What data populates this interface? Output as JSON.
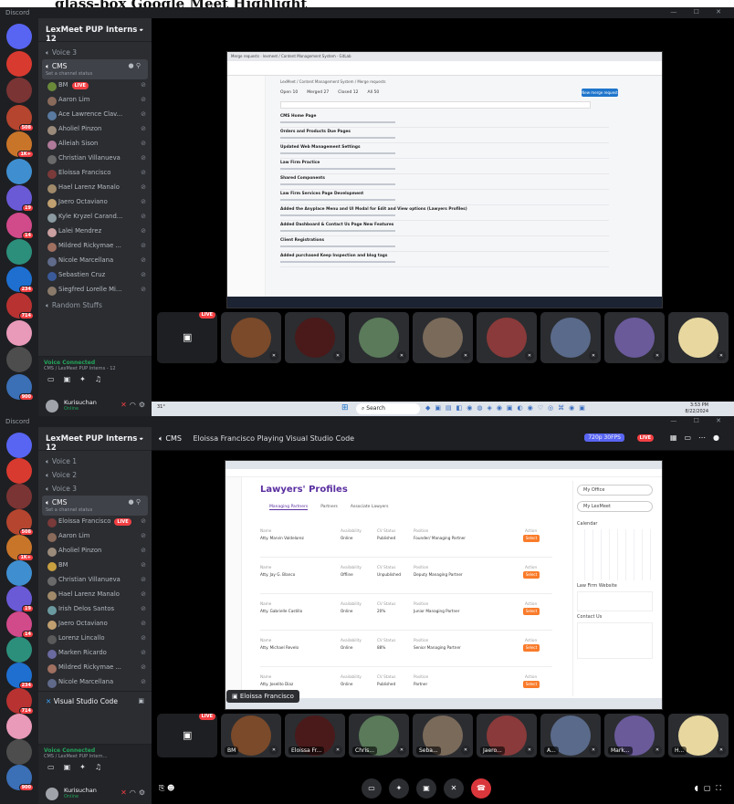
{
  "headline": "glass-box Google Meet Highlight",
  "window": {
    "app_name": "Discord",
    "controls": "— ☐ ✕"
  },
  "server": {
    "name": "LexMeet PUP Interns - 12"
  },
  "servers": [
    {
      "color": "#5865f2",
      "badge": ""
    },
    {
      "color": "#d93a2f",
      "badge": ""
    },
    {
      "color": "#7a3434",
      "badge": ""
    },
    {
      "color": "#b5452f",
      "badge": "508"
    },
    {
      "color": "#c8752a",
      "badge": "1K+"
    },
    {
      "color": "#3f8fd0",
      "badge": ""
    },
    {
      "color": "#6a5ad6",
      "badge": "19"
    },
    {
      "color": "#d14a8a",
      "badge": "14"
    },
    {
      "color": "#2c8f7c",
      "badge": ""
    },
    {
      "color": "#1e6fd0",
      "badge": "234"
    },
    {
      "color": "#b83232",
      "badge": "714"
    },
    {
      "color": "#e89ab8",
      "badge": ""
    },
    {
      "color": "#4d4d4d",
      "badge": ""
    },
    {
      "color": "#3b6fb6",
      "badge": "900"
    }
  ],
  "panel1": {
    "channels": [
      {
        "icon": "speaker",
        "label": "Voice 3"
      }
    ],
    "current": {
      "label": "CMS",
      "status": "Set a channel status"
    },
    "members": [
      {
        "name": "BM",
        "live": true,
        "color": "#6a8a3a"
      },
      {
        "name": "Aaron Lim",
        "live": false,
        "color": "#8a6a5a"
      },
      {
        "name": "Ace Lawrence Clav...",
        "live": false,
        "color": "#5a7aa0"
      },
      {
        "name": "Aholiel Pinzon",
        "live": false,
        "color": "#9a8a7a"
      },
      {
        "name": "Alleiah Sison",
        "live": false,
        "color": "#b07a9a"
      },
      {
        "name": "Christian Villanueva",
        "live": false,
        "color": "#6a6a6a"
      },
      {
        "name": "Eloissa Francisco",
        "live": false,
        "color": "#7a3a3a"
      },
      {
        "name": "Hael Larenz Manalo",
        "live": false,
        "color": "#a08a6a"
      },
      {
        "name": "Jaero Octaviano",
        "live": false,
        "color": "#c0a070"
      },
      {
        "name": "Kyle Kryzel Carand...",
        "live": false,
        "color": "#8a9aa0"
      },
      {
        "name": "Lalei Mendrez",
        "live": false,
        "color": "#caa0a0"
      },
      {
        "name": "Mildred Rickymae ...",
        "live": false,
        "color": "#a07060"
      },
      {
        "name": "Nicole Marcellana",
        "live": false,
        "color": "#606a8a"
      },
      {
        "name": "Sebastien Cruz",
        "live": false,
        "color": "#3a5a9a"
      },
      {
        "name": "Siegfred Lorelle Mi...",
        "live": false,
        "color": "#8a7a6a"
      }
    ],
    "after": {
      "label": "Random Stuffs"
    },
    "voice": {
      "title": "Voice Connected",
      "sub": "CMS / LexMeet PUP Interns - 12"
    },
    "user": {
      "name": "Kurisuchan",
      "status": "Online"
    },
    "stream": {
      "browser_tab": "Merge requests · lexmeet / Content Management System · GitLab",
      "breadcrumb": "LexMeet / Content Management System / Merge requests",
      "tabs": [
        "Open 10",
        "Merged 27",
        "Closed 12",
        "All 50"
      ],
      "new_button": "New merge request",
      "items": [
        "CMS Home Page",
        "Orders and Products Due Pages",
        "Updated Web Management Settings",
        "Law Firm Practice",
        "Shared Components",
        "Law Firm Services Page Development",
        "Added the Anyplace Menu and UI Modal for Edit and View options (Lawyers Profiles)",
        "Added Dashboard & Contact Us Page New Features",
        "Client Registrations",
        "Added purchased Keep Inspection and blog tags"
      ]
    },
    "taskbar": {
      "search": "Search",
      "time": "3:53 PM",
      "date": "8/22/2024",
      "temp": "31°"
    }
  },
  "panel2": {
    "channels": [
      {
        "label": "Voice 1"
      },
      {
        "label": "Voice 2"
      },
      {
        "label": "Voice 3"
      }
    ],
    "current": {
      "label": "CMS",
      "status": "Set a channel status"
    },
    "members": [
      {
        "name": "Eloissa Francisco",
        "live": true,
        "color": "#7a3a3a"
      },
      {
        "name": "Aaron Lim",
        "live": false,
        "color": "#8a6a5a"
      },
      {
        "name": "Aholiel Pinzon",
        "live": false,
        "color": "#9a8a7a"
      },
      {
        "name": "BM",
        "live": false,
        "color": "#c8a040"
      },
      {
        "name": "Christian Villanueva",
        "live": false,
        "color": "#6a6a6a"
      },
      {
        "name": "Hael Larenz Manalo",
        "live": false,
        "color": "#a08a6a"
      },
      {
        "name": "Irish Delos Santos",
        "live": false,
        "color": "#6a9aa0"
      },
      {
        "name": "Jaero Octaviano",
        "live": false,
        "color": "#c0a070"
      },
      {
        "name": "Lorenz Lincallo",
        "live": false,
        "color": "#5a5a5a"
      },
      {
        "name": "Marken Ricardo",
        "live": false,
        "color": "#6a6aa0"
      },
      {
        "name": "Mildred Rickymae ...",
        "live": false,
        "color": "#a07060"
      },
      {
        "name": "Nicole Marcellana",
        "live": false,
        "color": "#606a8a"
      }
    ],
    "activity": {
      "label": "Visual Studio Code"
    },
    "voice": {
      "title": "Voice Connected",
      "sub": "CMS / LexMeet PUP Intern..."
    },
    "user": {
      "name": "Kurisuchan",
      "status": "Online"
    },
    "topbar": {
      "channel": "CMS",
      "activity": "Eloissa Francisco Playing Visual Studio Code",
      "quality": "720p 30FPS",
      "live": "LIVE"
    },
    "stream": {
      "title": "Lawyers' Profiles",
      "tabs": [
        "Managing Partners",
        "Partners",
        "Associate Lawyers"
      ],
      "rows": [
        {
          "name": "Atty. Marvin Valdelarez",
          "availability": "Online",
          "cv": "Published",
          "position": "Founder/ Managing Partner"
        },
        {
          "name": "Atty. Jay G. Blanco",
          "availability": "Offline",
          "cv": "Unpublished",
          "position": "Deputy Managing Partner"
        },
        {
          "name": "Atty. Gabrielle Castillo",
          "availability": "Online",
          "cv": "20%",
          "position": "Junior Managing Partner"
        },
        {
          "name": "Atty. Michael Revelo",
          "availability": "Online",
          "cv": "88%",
          "position": "Senior Managing Partner"
        },
        {
          "name": "Atty. Joselito Diaz",
          "availability": "Online",
          "cv": "Published",
          "position": "Partner"
        }
      ],
      "col_labels": {
        "name": "Name",
        "availability": "Availability",
        "cv": "CV Status",
        "position": "Position",
        "action": "Action"
      },
      "action_button": "Select",
      "right_links": [
        "My Office",
        "My LexMeet"
      ],
      "calendar_label": "Calendar",
      "firm_label": "Law Firm Website",
      "contact_label": "Contact Us",
      "streamer": "Eloissa Francisco"
    },
    "tiles": [
      "BM",
      "Eloissa Fr...",
      "Chris...",
      "Seba...",
      "Jaero...",
      "A...",
      "Mark...",
      "H..."
    ]
  }
}
